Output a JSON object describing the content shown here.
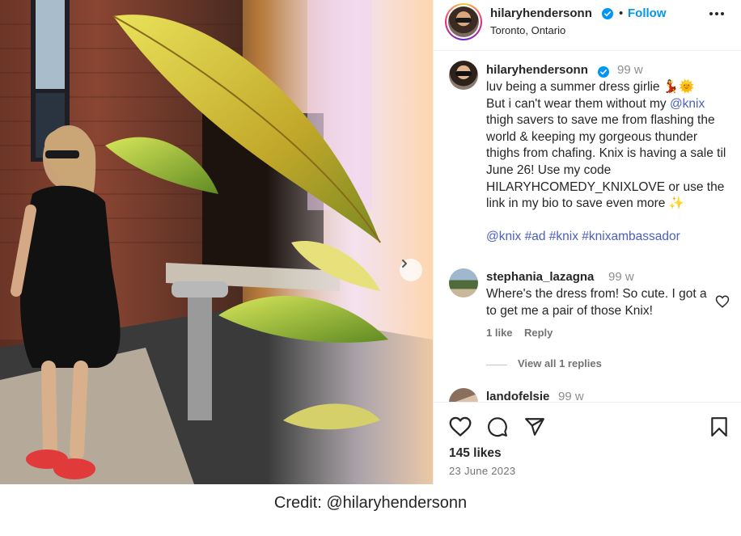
{
  "post": {
    "username": "hilaryhendersonn",
    "follow_label": "Follow",
    "dot": "•",
    "location": "Toronto, Ontario",
    "more_label": "•••"
  },
  "caption": {
    "username": "hilaryhendersonn",
    "time": "99 w",
    "line1": "luv being a summer dress girlie 💃🌞",
    "line2_pre": "But i can't wear them without my ",
    "mention": "@knix",
    "line2_post": " thigh savers to save me from flashing the world & keeping my gorgeous thunder thighs from chafing. Knix is having a sale til June 26! Use my code HILARYHCOMEDY_KNIXLOVE or use the link in my bio to save even more ✨",
    "hashtags": "@knix #ad #knix #knixambassador"
  },
  "comments": [
    {
      "username": "stephania_lazagna",
      "time": "99 w",
      "text": "Where's the dress from! So cute. I got a to get me a pair of those Knix!",
      "likes": "1 like",
      "reply_label": "Reply",
      "view_replies": "View all 1 replies"
    },
    {
      "username": "landofelsie",
      "time": "99 w"
    }
  ],
  "actions": {
    "likes": "145 likes",
    "date": "23 June 2023"
  },
  "icons": {
    "like": "heart-icon",
    "comment": "comment-icon",
    "share": "share-icon",
    "save": "bookmark-icon",
    "verified": "verified-badge-icon",
    "next": "chevron-right-icon",
    "more": "more-options-icon"
  },
  "colors": {
    "link": "#0095f6",
    "mention": "#4a5fc1",
    "muted": "#8e8e8e"
  },
  "credit": "Credit: @hilaryhendersonn"
}
